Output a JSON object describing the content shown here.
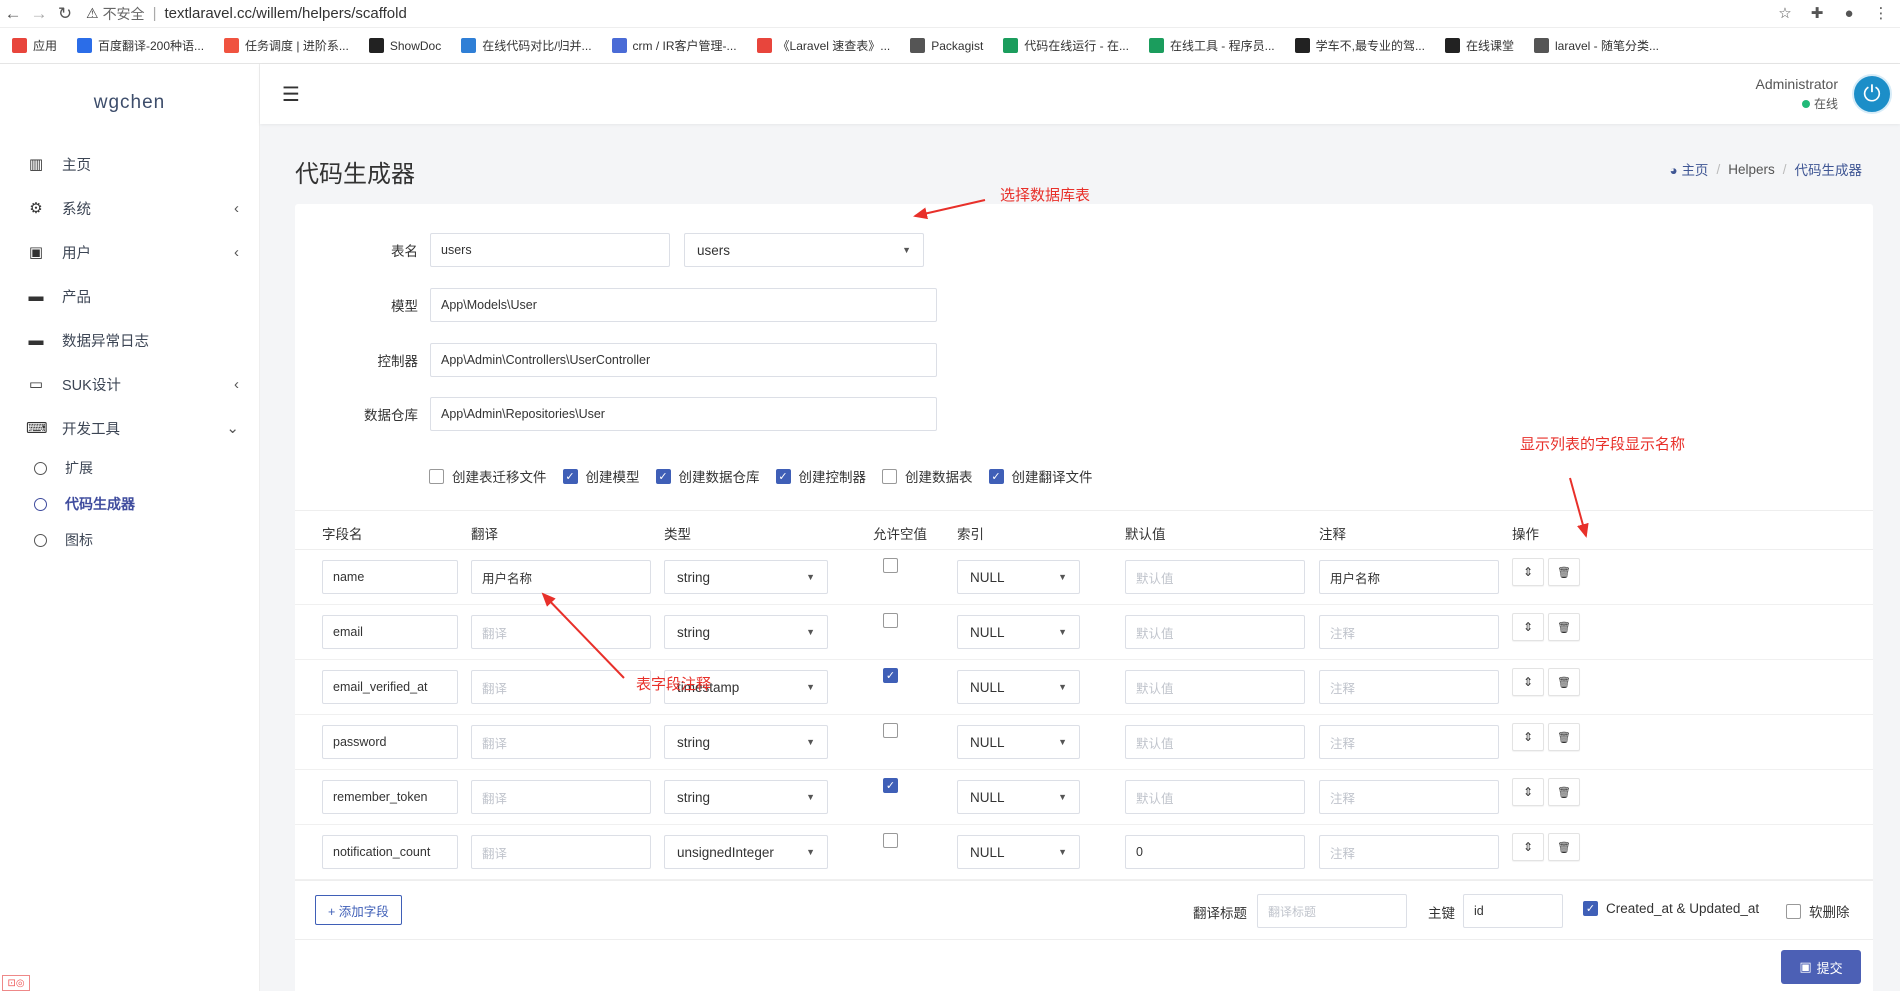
{
  "browser": {
    "insecure": "不安全",
    "url": "textlaravel.cc/willem/helpers/scaffold",
    "bookmarks": [
      {
        "label": "应用",
        "icon": "apps-grid-icon",
        "color": "#e8453c"
      },
      {
        "label": "百度翻译-200种语...",
        "icon": "translate-icon",
        "color": "#2b6de8"
      },
      {
        "label": "任务调度 | 进阶系...",
        "icon": "laravel-icon",
        "color": "#f05340"
      },
      {
        "label": "ShowDoc",
        "icon": "showdoc-icon",
        "color": "#222222"
      },
      {
        "label": "在线代码对比/归并...",
        "icon": "diff-icon",
        "color": "#2f7fd6"
      },
      {
        "label": "crm / IR客户管理-...",
        "icon": "crm-icon",
        "color": "#4a6bd6"
      },
      {
        "label": "《Laravel 速查表》...",
        "icon": "cheatsheet-icon",
        "color": "#e8453c"
      },
      {
        "label": "Packagist",
        "icon": "packagist-icon",
        "color": "#555555"
      },
      {
        "label": "代码在线运行 - 在...",
        "icon": "runcode-icon",
        "color": "#1b9d5d"
      },
      {
        "label": "在线工具 - 程序员...",
        "icon": "tools-icon",
        "color": "#1b9d5d"
      },
      {
        "label": "学车不,最专业的驾...",
        "icon": "fox-icon",
        "color": "#222222"
      },
      {
        "label": "在线课堂",
        "icon": "fox-icon",
        "color": "#222222"
      },
      {
        "label": "laravel - 随笔分类...",
        "icon": "blog-icon",
        "color": "#555555"
      }
    ]
  },
  "sidebar": {
    "brand": "wgchen",
    "items": [
      {
        "label": "主页",
        "icon": "bar-chart-icon",
        "glyph": "▥",
        "chevron": ""
      },
      {
        "label": "系统",
        "icon": "gear-icon",
        "glyph": "⚙",
        "chevron": "‹"
      },
      {
        "label": "用户",
        "icon": "user-file-icon",
        "glyph": "▣",
        "chevron": "‹"
      },
      {
        "label": "产品",
        "icon": "stripe-icon",
        "glyph": "▬",
        "chevron": ""
      },
      {
        "label": "数据异常日志",
        "icon": "paypal-icon",
        "glyph": "▬",
        "chevron": ""
      },
      {
        "label": "SUK设计",
        "icon": "card-icon",
        "glyph": "▭",
        "chevron": "‹"
      },
      {
        "label": "开发工具",
        "icon": "keyboard-icon",
        "glyph": "⌨",
        "chevron": "⌄"
      }
    ],
    "subitems": [
      {
        "label": "扩展",
        "active": false
      },
      {
        "label": "代码生成器",
        "active": true
      },
      {
        "label": "图标",
        "active": false
      }
    ]
  },
  "header": {
    "user_name": "Administrator",
    "user_status": "在线"
  },
  "page": {
    "title": "代码生成器",
    "breadcrumb": {
      "home": "主页",
      "mid": "Helpers",
      "current": "代码生成器"
    }
  },
  "form": {
    "table_label": "表名",
    "table_value": "users",
    "table_select": "users",
    "model_label": "模型",
    "model_value": "App\\Models\\User",
    "controller_label": "控制器",
    "controller_value": "App\\Admin\\Controllers\\UserController",
    "repo_label": "数据仓库",
    "repo_value": "App\\Admin\\Repositories\\User",
    "options": [
      {
        "label": "创建表迁移文件",
        "checked": false
      },
      {
        "label": "创建模型",
        "checked": true
      },
      {
        "label": "创建数据仓库",
        "checked": true
      },
      {
        "label": "创建控制器",
        "checked": true
      },
      {
        "label": "创建数据表",
        "checked": false
      },
      {
        "label": "创建翻译文件",
        "checked": true
      }
    ]
  },
  "table": {
    "headers": [
      "字段名",
      "翻译",
      "类型",
      "允许空值",
      "索引",
      "默认值",
      "注释",
      "操作"
    ],
    "placeholders": {
      "translate": "翻译",
      "default": "默认值",
      "comment": "注释"
    },
    "rows": [
      {
        "field": "name",
        "translate": "用户名称",
        "type": "string",
        "nullable": false,
        "index": "NULL",
        "default": "",
        "comment": "用户名称"
      },
      {
        "field": "email",
        "translate": "",
        "type": "string",
        "nullable": false,
        "index": "NULL",
        "default": "",
        "comment": ""
      },
      {
        "field": "email_verified_at",
        "translate": "",
        "type": "timestamp",
        "nullable": true,
        "index": "NULL",
        "default": "",
        "comment": ""
      },
      {
        "field": "password",
        "translate": "",
        "type": "string",
        "nullable": false,
        "index": "NULL",
        "default": "",
        "comment": ""
      },
      {
        "field": "remember_token",
        "translate": "",
        "type": "string",
        "nullable": true,
        "index": "NULL",
        "default": "",
        "comment": ""
      },
      {
        "field": "notification_count",
        "translate": "",
        "type": "unsignedInteger",
        "nullable": false,
        "index": "NULL",
        "default": "0",
        "comment": ""
      }
    ]
  },
  "bottom": {
    "add_field": "+ 添加字段",
    "title_label": "翻译标题",
    "title_placeholder": "翻译标题",
    "pk_label": "主键",
    "pk_value": "id",
    "timestamps_label": "Created_at & Updated_at",
    "timestamps_checked": true,
    "softdelete_label": "软删除",
    "softdelete_checked": false,
    "submit": "提交"
  },
  "annotations": {
    "select_table": "选择数据库表",
    "display_name": "显示列表的字段显示名称",
    "field_comment": "表字段注释"
  },
  "colors": {
    "accent": "#3f5fb7",
    "annotation": "#e8302a",
    "online": "#21b978"
  }
}
